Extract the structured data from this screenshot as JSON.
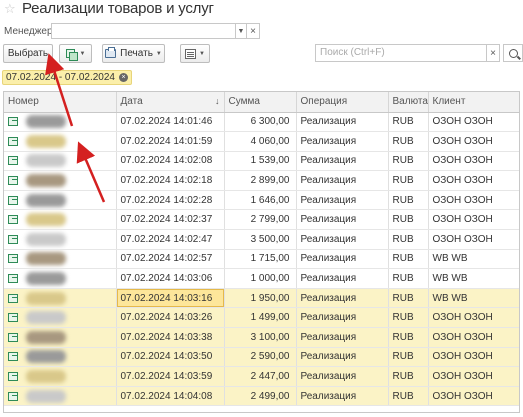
{
  "header": {
    "title": "Реализации товаров и услуг"
  },
  "manager": {
    "label": "Менеджер:",
    "value": ""
  },
  "toolbar": {
    "select_label": "Выбрать",
    "print_label": "Печать"
  },
  "search": {
    "placeholder": "Поиск (Ctrl+F)"
  },
  "filter": {
    "label": "07.02.2024 - 07.02.2024"
  },
  "table": {
    "columns": [
      "Номер",
      "Дата",
      "Сумма",
      "Операция",
      "Валюта",
      "Клиент"
    ],
    "sort_column": "Дата",
    "rows": [
      {
        "date": "07.02.2024 14:01:46",
        "sum": "6 300,00",
        "op": "Реализация",
        "cur": "RUB",
        "client": "ОЗОН ОЗОН",
        "hl": false
      },
      {
        "date": "07.02.2024 14:01:59",
        "sum": "4 060,00",
        "op": "Реализация",
        "cur": "RUB",
        "client": "ОЗОН ОЗОН",
        "hl": false
      },
      {
        "date": "07.02.2024 14:02:08",
        "sum": "1 539,00",
        "op": "Реализация",
        "cur": "RUB",
        "client": "ОЗОН ОЗОН",
        "hl": false
      },
      {
        "date": "07.02.2024 14:02:18",
        "sum": "2 899,00",
        "op": "Реализация",
        "cur": "RUB",
        "client": "ОЗОН ОЗОН",
        "hl": false
      },
      {
        "date": "07.02.2024 14:02:28",
        "sum": "1 646,00",
        "op": "Реализация",
        "cur": "RUB",
        "client": "ОЗОН ОЗОН",
        "hl": false
      },
      {
        "date": "07.02.2024 14:02:37",
        "sum": "2 799,00",
        "op": "Реализация",
        "cur": "RUB",
        "client": "ОЗОН ОЗОН",
        "hl": false
      },
      {
        "date": "07.02.2024 14:02:47",
        "sum": "3 500,00",
        "op": "Реализация",
        "cur": "RUB",
        "client": "ОЗОН ОЗОН",
        "hl": false
      },
      {
        "date": "07.02.2024 14:02:57",
        "sum": "1 715,00",
        "op": "Реализация",
        "cur": "RUB",
        "client": "WB WB",
        "hl": false
      },
      {
        "date": "07.02.2024 14:03:06",
        "sum": "1 000,00",
        "op": "Реализация",
        "cur": "RUB",
        "client": "WB WB",
        "hl": false
      },
      {
        "date": "07.02.2024 14:03:16",
        "sum": "1 950,00",
        "op": "Реализация",
        "cur": "RUB",
        "client": "WB WB",
        "hl": true
      },
      {
        "date": "07.02.2024 14:03:26",
        "sum": "1 499,00",
        "op": "Реализация",
        "cur": "RUB",
        "client": "ОЗОН ОЗОН",
        "hl": true
      },
      {
        "date": "07.02.2024 14:03:38",
        "sum": "3 100,00",
        "op": "Реализация",
        "cur": "RUB",
        "client": "ОЗОН ОЗОН",
        "hl": true
      },
      {
        "date": "07.02.2024 14:03:50",
        "sum": "2 590,00",
        "op": "Реализация",
        "cur": "RUB",
        "client": "ОЗОН ОЗОН",
        "hl": true
      },
      {
        "date": "07.02.2024 14:03:59",
        "sum": "2 447,00",
        "op": "Реализация",
        "cur": "RUB",
        "client": "ОЗОН ОЗОН",
        "hl": true
      },
      {
        "date": "07.02.2024 14:04:08",
        "sum": "2 499,00",
        "op": "Реализация",
        "cur": "RUB",
        "client": "ОЗОН ОЗОН",
        "hl": true
      }
    ]
  },
  "colors": {
    "accent_arrow": "#d42020",
    "highlight_row": "#fbf3c6",
    "current_cell": "#fde69a"
  }
}
